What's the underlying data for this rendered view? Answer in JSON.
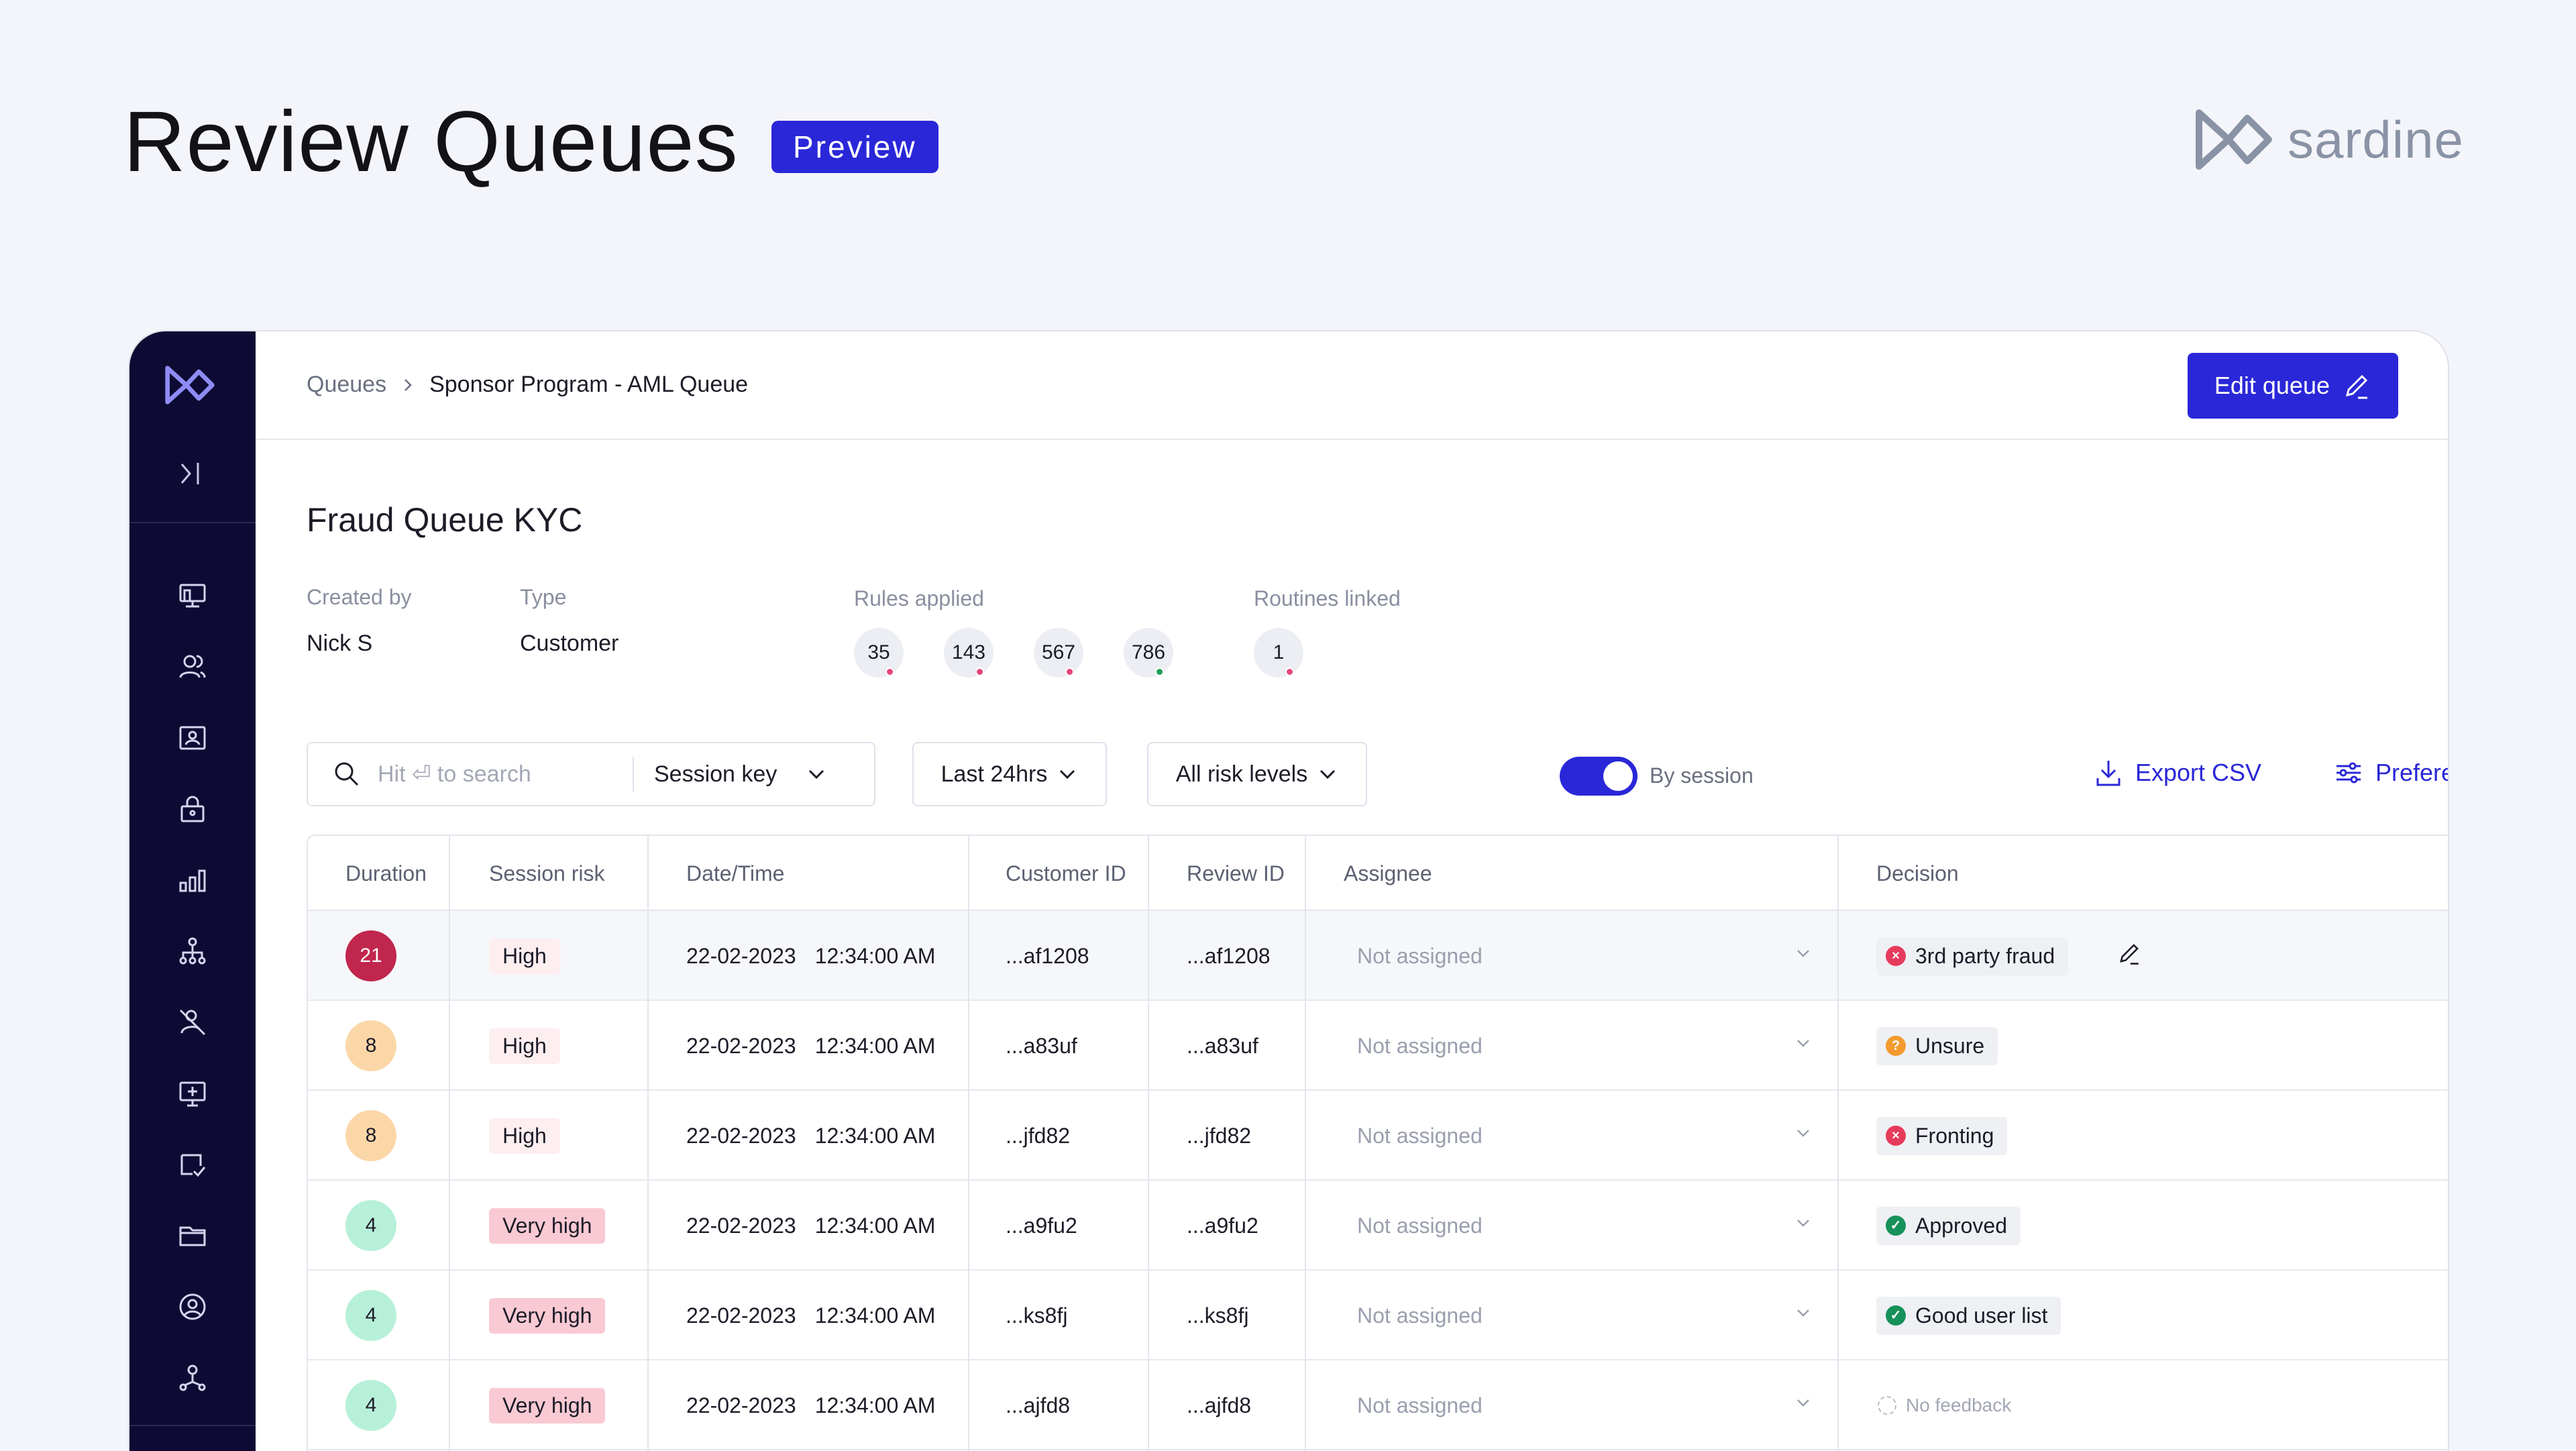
{
  "page": {
    "title": "Review Queues",
    "badge": "Preview",
    "brand": "sardine"
  },
  "colors": {
    "accent": "#2a27d8",
    "sidebar": "#0d0b33",
    "background": "#f4f5fa"
  },
  "breadcrumb": {
    "root": "Queues",
    "current": "Sponsor Program - AML Queue"
  },
  "header": {
    "edit_button": "Edit queue"
  },
  "queue": {
    "title": "Fraud Queue KYC",
    "created_by_label": "Created by",
    "created_by": "Nick S",
    "type_label": "Type",
    "type": "Customer",
    "rules_label": "Rules applied",
    "rules": [
      {
        "id": "35",
        "dot": "#e6457a"
      },
      {
        "id": "143",
        "dot": "#e6457a"
      },
      {
        "id": "567",
        "dot": "#e6457a"
      },
      {
        "id": "786",
        "dot": "#1f9d57"
      }
    ],
    "routines_label": "Routines linked",
    "routines": [
      {
        "id": "1",
        "dot": "#e6457a"
      }
    ]
  },
  "filters": {
    "search_placeholder": "Hit ⏎ to search",
    "search_key": "Session key",
    "time": "Last 24hrs",
    "risk": "All risk levels",
    "toggle_label": "By session",
    "toggle_on": true,
    "export": "Export CSV",
    "preference": "Preference"
  },
  "table": {
    "columns": [
      "Duration",
      "Session risk",
      "Date/Time",
      "Customer ID",
      "Review ID",
      "Assignee",
      "Decision"
    ],
    "rows": [
      {
        "duration": "21",
        "dur_level": "red",
        "risk": "High",
        "risk_level": "high",
        "date": "22-02-2023",
        "time": "12:34:00 AM",
        "customer": "...af1208",
        "review": "...af1208",
        "assignee": "Not assigned",
        "decision": "3rd party fraud",
        "decision_type": "fraud",
        "highlighted": true
      },
      {
        "duration": "8",
        "dur_level": "orange",
        "risk": "High",
        "risk_level": "high",
        "date": "22-02-2023",
        "time": "12:34:00 AM",
        "customer": "...a83uf",
        "review": "...a83uf",
        "assignee": "Not assigned",
        "decision": "Unsure",
        "decision_type": "unsure",
        "highlighted": false
      },
      {
        "duration": "8",
        "dur_level": "orange",
        "risk": "High",
        "risk_level": "high",
        "date": "22-02-2023",
        "time": "12:34:00 AM",
        "customer": "...jfd82",
        "review": "...jfd82",
        "assignee": "Not assigned",
        "decision": "Fronting",
        "decision_type": "fraud",
        "highlighted": false
      },
      {
        "duration": "4",
        "dur_level": "green",
        "risk": "Very high",
        "risk_level": "veryhigh",
        "date": "22-02-2023",
        "time": "12:34:00 AM",
        "customer": "...a9fu2",
        "review": "...a9fu2",
        "assignee": "Not assigned",
        "decision": "Approved",
        "decision_type": "approved",
        "highlighted": false
      },
      {
        "duration": "4",
        "dur_level": "green",
        "risk": "Very high",
        "risk_level": "veryhigh",
        "date": "22-02-2023",
        "time": "12:34:00 AM",
        "customer": "...ks8fj",
        "review": "...ks8fj",
        "assignee": "Not assigned",
        "decision": "Good user list",
        "decision_type": "approved",
        "highlighted": false
      },
      {
        "duration": "4",
        "dur_level": "green",
        "risk": "Very high",
        "risk_level": "veryhigh",
        "date": "22-02-2023",
        "time": "12:34:00 AM",
        "customer": "...ajfd8",
        "review": "...ajfd8",
        "assignee": "Not assigned",
        "decision": "No feedback",
        "decision_type": "none",
        "highlighted": false
      }
    ]
  }
}
